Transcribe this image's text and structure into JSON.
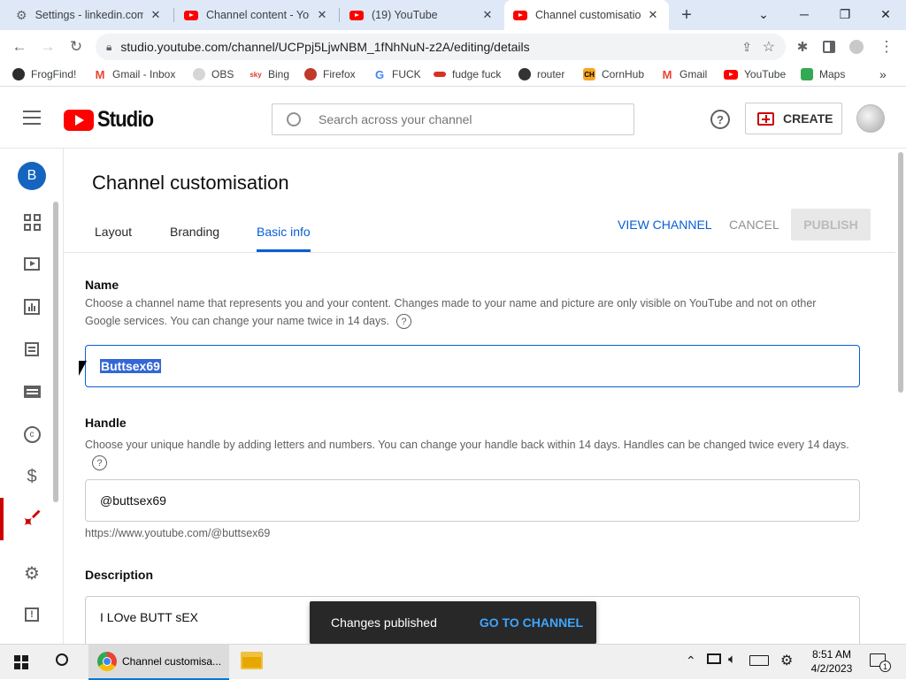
{
  "browser": {
    "tabs": [
      {
        "title": "Settings - linkedin.com",
        "icon": "gear-icon"
      },
      {
        "title": "Channel content - YouTube",
        "icon": "youtube-icon"
      },
      {
        "title": "(19) YouTube",
        "icon": "youtube-icon"
      },
      {
        "title": "Channel customisation",
        "icon": "youtube-icon"
      }
    ],
    "url": "studio.youtube.com/channel/UCPpj5LjwNBM_1fNhNuN-z2A/editing/details",
    "bookmarks": [
      "FrogFind!",
      "Gmail - Inbox",
      "OBS",
      "Bing",
      "Firefox",
      "FUCK",
      "fudge fuck",
      "router",
      "CornHub",
      "Gmail",
      "YouTube",
      "Maps"
    ],
    "bookmark_colors": [
      "#2d2d2d",
      "#ea4335",
      "#777777",
      "#e33b2e",
      "#c0392b",
      "#4285f4",
      "#d93025",
      "#333333",
      "#f5a623",
      "#ea4335",
      "#ff0000",
      "#34a853"
    ]
  },
  "studio": {
    "logo_text": "Studio",
    "search_placeholder": "Search across your channel",
    "create_label": "CREATE",
    "avatar_letter": "B"
  },
  "page": {
    "title": "Channel customisation",
    "tabs": [
      "Layout",
      "Branding",
      "Basic info"
    ],
    "active_tab": "Basic info",
    "view_channel": "VIEW CHANNEL",
    "cancel": "CANCEL",
    "publish": "PUBLISH"
  },
  "name_section": {
    "heading": "Name",
    "description": "Choose a channel name that represents you and your content. Changes made to your name and picture are only visible on YouTube and not on other Google services. You can change your name twice in 14 days.",
    "value": "Buttsex69"
  },
  "handle_section": {
    "heading": "Handle",
    "description": "Choose your unique handle by adding letters and numbers. You can change your handle back within 14 days. Handles can be changed twice every 14 days.",
    "value": "@buttsex69",
    "url": "https://www.youtube.com/@buttsex69"
  },
  "description_section": {
    "heading": "Description",
    "value": "I LOve BUTT sEX"
  },
  "toast": {
    "message": "Changes published",
    "action": "GO TO CHANNEL"
  },
  "taskbar": {
    "active_app": "Channel customisa...",
    "time": "8:51 AM",
    "date": "4/2/2023",
    "notification_count": "1"
  },
  "colors": {
    "accent_blue": "#065fd4",
    "youtube_red": "#ff0000",
    "selection_blue": "#3367d6"
  }
}
